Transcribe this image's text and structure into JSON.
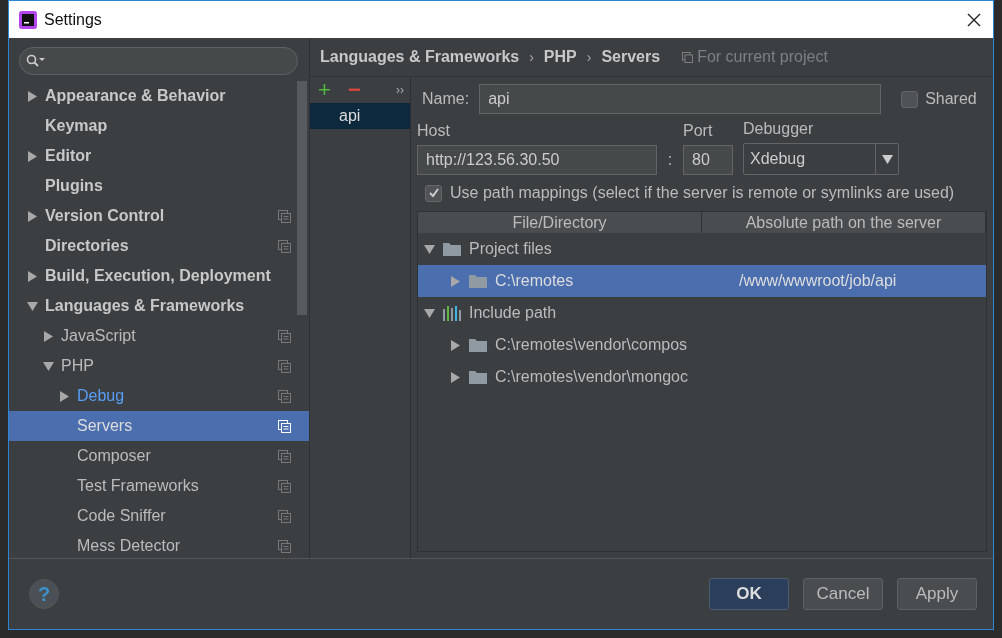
{
  "window": {
    "title": "Settings"
  },
  "sidebar": {
    "items": [
      {
        "label": "Appearance & Behavior",
        "kind": "folder",
        "expanded": false,
        "project": false,
        "selected": false,
        "highlighted": false
      },
      {
        "label": "Keymap",
        "kind": "leaf",
        "project": false,
        "selected": false,
        "highlighted": false
      },
      {
        "label": "Editor",
        "kind": "folder",
        "expanded": false,
        "project": false,
        "selected": false,
        "highlighted": false
      },
      {
        "label": "Plugins",
        "kind": "leaf",
        "project": false,
        "selected": false,
        "highlighted": false
      },
      {
        "label": "Version Control",
        "kind": "folder",
        "expanded": false,
        "project": true,
        "selected": false,
        "highlighted": false
      },
      {
        "label": "Directories",
        "kind": "leaf",
        "project": true,
        "selected": false,
        "highlighted": false
      },
      {
        "label": "Build, Execution, Deployment",
        "kind": "folder",
        "expanded": false,
        "project": false,
        "selected": false,
        "highlighted": false
      },
      {
        "label": "Languages & Frameworks",
        "kind": "folder",
        "expanded": true,
        "project": false,
        "selected": false,
        "highlighted": false,
        "children": [
          {
            "label": "JavaScript",
            "kind": "folder",
            "expanded": false,
            "project": true,
            "selected": false,
            "highlighted": false
          },
          {
            "label": "PHP",
            "kind": "folder",
            "expanded": true,
            "project": true,
            "selected": false,
            "highlighted": false,
            "children": [
              {
                "label": "Debug",
                "kind": "folder",
                "expanded": false,
                "project": true,
                "selected": false,
                "highlighted": true
              },
              {
                "label": "Servers",
                "kind": "leaf",
                "project": true,
                "selected": true,
                "highlighted": false
              },
              {
                "label": "Composer",
                "kind": "leaf",
                "project": true,
                "selected": false,
                "highlighted": false
              },
              {
                "label": "Test Frameworks",
                "kind": "leaf",
                "project": true,
                "selected": false,
                "highlighted": false
              },
              {
                "label": "Code Sniffer",
                "kind": "leaf",
                "project": true,
                "selected": false,
                "highlighted": false
              },
              {
                "label": "Mess Detector",
                "kind": "leaf",
                "project": true,
                "selected": false,
                "highlighted": false
              }
            ]
          }
        ]
      }
    ]
  },
  "breadcrumb": {
    "parts": [
      "Languages & Frameworks",
      "PHP",
      "Servers"
    ],
    "separators": [
      "›",
      "›"
    ],
    "scope": "For current project"
  },
  "servers": {
    "toolbar": {
      "add": "+",
      "remove": "−",
      "more": "››"
    },
    "items": [
      {
        "label": "api",
        "selected": true
      }
    ]
  },
  "form": {
    "name_label": "Name:",
    "name": "api",
    "shared_label": "Shared",
    "shared": false,
    "host_label": "Host",
    "host": "http://123.56.30.50",
    "colon": ":",
    "port_label": "Port",
    "port": "80",
    "debugger_label": "Debugger",
    "debugger": "Xdebug",
    "use_mappings_label": "Use path mappings (select if the server is remote or symlinks are used)",
    "use_mappings": true
  },
  "mappings": {
    "columns": [
      "File/Directory",
      "Absolute path on the server"
    ],
    "rows": [
      {
        "file": "Project files",
        "kind": "folder",
        "expanded": true,
        "selected": false,
        "children": [
          {
            "file": "C:\\remotes",
            "server_path": "/www/wwwroot/job/api",
            "kind": "folder",
            "expanded": false,
            "selected": true
          }
        ]
      },
      {
        "file": "Include path",
        "kind": "library",
        "expanded": true,
        "selected": false,
        "children": [
          {
            "file": "C:\\remotes\\vendor\\compos",
            "kind": "folder",
            "expanded": false,
            "selected": false
          },
          {
            "file": "C:\\remotes\\vendor\\mongoc",
            "kind": "folder",
            "expanded": false,
            "selected": false
          }
        ]
      }
    ]
  },
  "help": "?",
  "buttons": [
    {
      "label": "OK",
      "kind": "default"
    },
    {
      "label": "Cancel",
      "kind": "normal"
    },
    {
      "label": "Apply",
      "kind": "normal"
    }
  ]
}
